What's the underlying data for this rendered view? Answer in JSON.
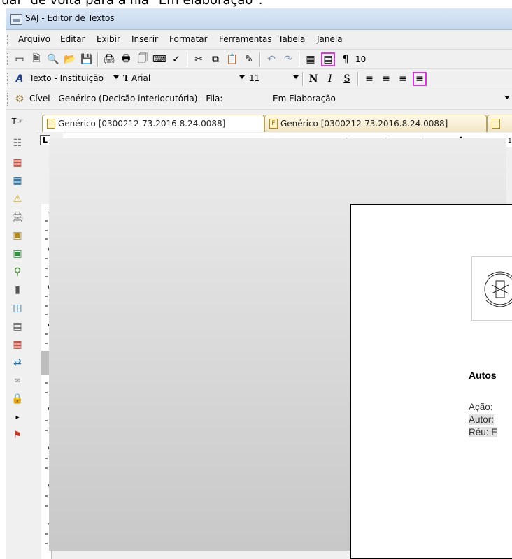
{
  "caption": "ual\" de volta para a fila \"Em elaboração\".",
  "window": {
    "title": "SAJ - Editor de Textos"
  },
  "menubar": {
    "items": [
      {
        "label": "Arquivo"
      },
      {
        "label": "Editar"
      },
      {
        "label": "Exibir"
      },
      {
        "label": "Inserir"
      },
      {
        "label": "Formatar"
      },
      {
        "label": "Ferramentas"
      },
      {
        "label": "Tabela"
      },
      {
        "label": "Janela"
      }
    ]
  },
  "toolbar": {
    "pilcrow": "¶",
    "zoom": "10"
  },
  "format_bar": {
    "style": "Texto - Instituição",
    "font": "Arial",
    "size": "11",
    "bold_label": "N",
    "italic_label": "I",
    "underline_label": "S"
  },
  "phase_bar": {
    "model": "Cível - Genérico (Decisão interlocutória) - Fila:",
    "queue": "Em Elaboração"
  },
  "tabs": [
    {
      "label": "Genérico [0300212-73.2016.8.24.0088]",
      "icon": "document-icon"
    },
    {
      "label": "Genérico [0300212-73.2016.8.24.0088]",
      "icon": "form-f-icon"
    }
  ],
  "ruler": {
    "horizontal_labels": [
      "3",
      "2",
      "1",
      "1"
    ],
    "vertical_labels": [
      "4",
      "3",
      "2",
      "1",
      "1",
      "2",
      "3",
      "4"
    ]
  },
  "document": {
    "heading": "Autos",
    "lines": [
      "Ação:",
      "Autor:",
      "Réu: E"
    ]
  },
  "colors": {
    "highlight": "#d23ad6",
    "tab_border": "#b7a15e"
  }
}
